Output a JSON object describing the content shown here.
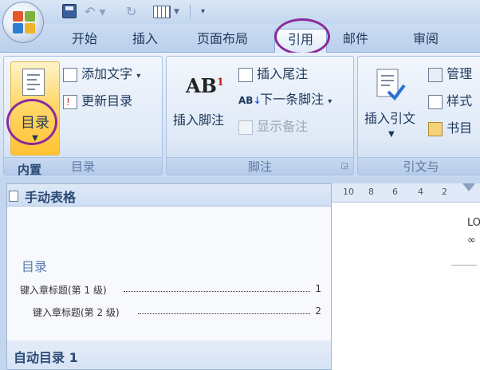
{
  "tabs": [
    "开始",
    "插入",
    "页面布局",
    "引用",
    "邮件",
    "审阅"
  ],
  "ribbon": {
    "toc": {
      "button": "目录",
      "add_text": "添加文字",
      "update_toc": "更新目录",
      "group_label": "目录"
    },
    "footnotes": {
      "insert_footnote": "插入脚注",
      "insert_endnote": "插入尾注",
      "next_footnote": "下一条脚注",
      "show_notes": "显示备注",
      "group_label": "脚注",
      "ab_text": "AB",
      "ab_sup": "1"
    },
    "citations": {
      "insert_citation": "插入引文",
      "manage": "管理",
      "style": "样式",
      "bibliography": "书目",
      "group_label": "引文与"
    }
  },
  "gallery": {
    "builtin_tooltip": "内置",
    "header": "手动表格",
    "preview_title": "目录",
    "entries": [
      {
        "text": "键入章标题(第 1 级)",
        "page": "1"
      },
      {
        "text": "键入章标题(第 2 级)",
        "page": "2"
      }
    ],
    "footer": "自动目录 1"
  },
  "ruler": [
    "10",
    "8",
    "6",
    "4",
    "2"
  ],
  "doc_text": [
    "LO",
    "∞"
  ]
}
